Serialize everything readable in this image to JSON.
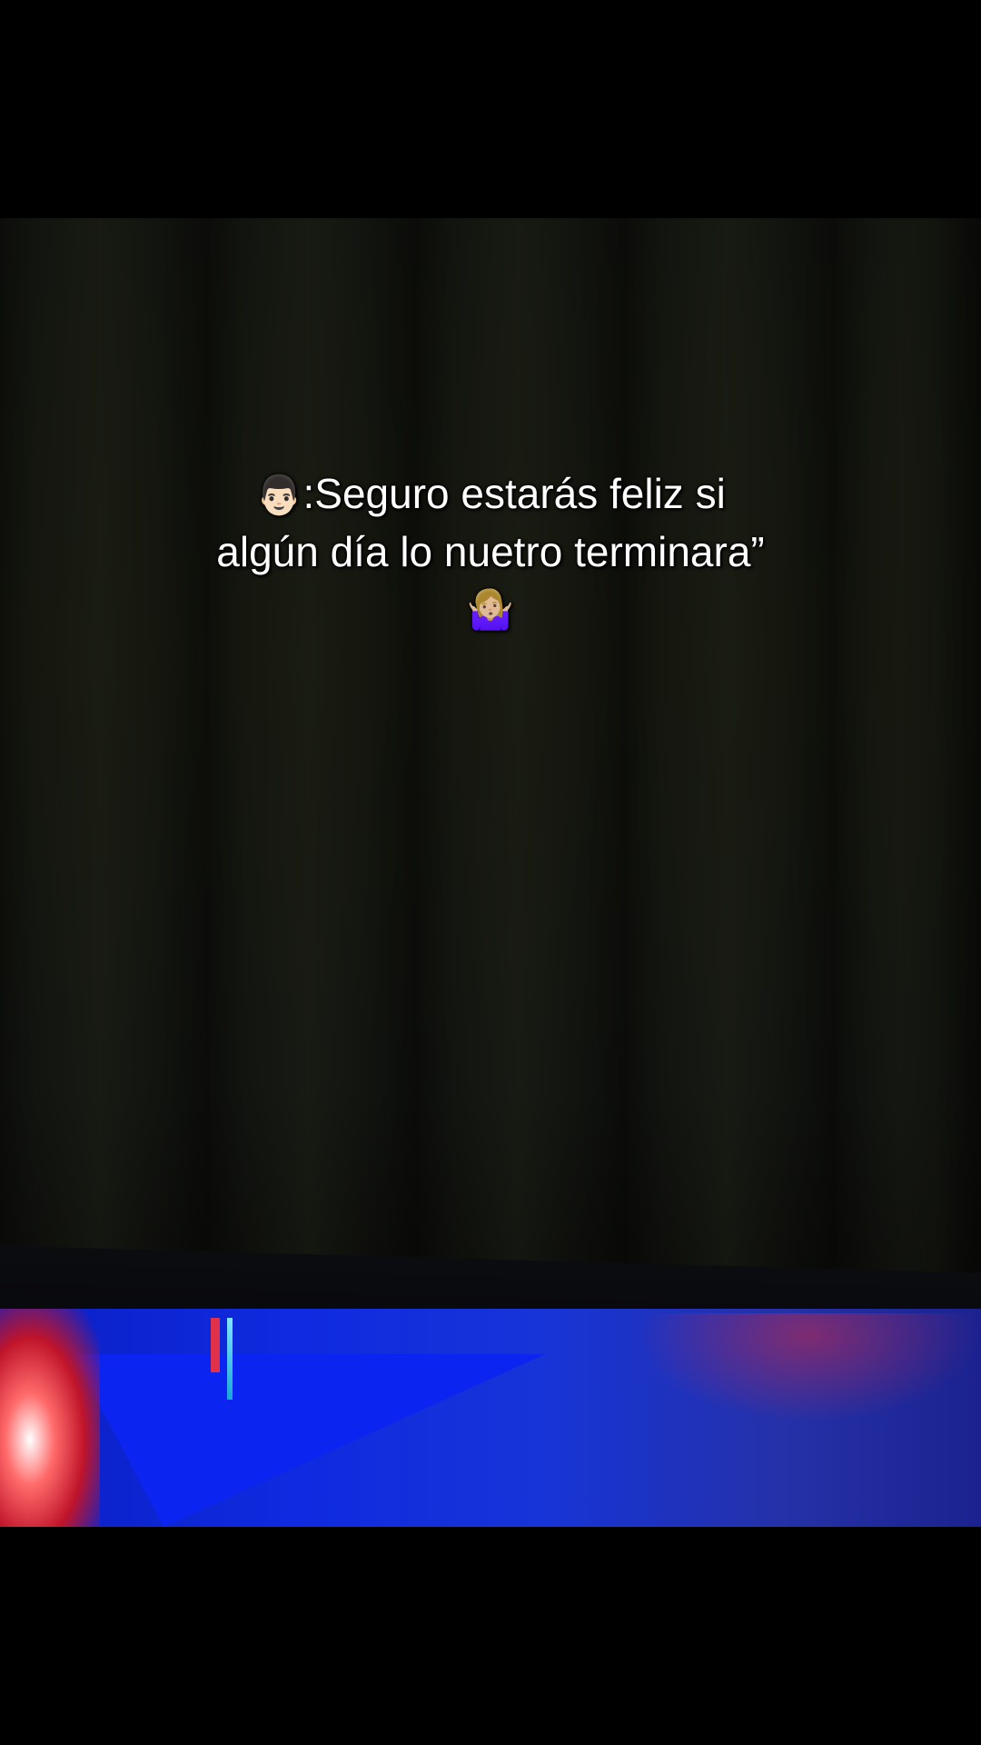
{
  "caption": {
    "speaker_emoji": "👨🏻",
    "line1": ":Seguro estarás feliz si",
    "line2": "algún día lo nuetro terminara”",
    "reaction_emoji": "🤷🏼‍♀️"
  },
  "colors": {
    "background": "#000000",
    "curtain": "#15170f",
    "tv_blue": "#0f2ae0",
    "tv_red": "#c0142a",
    "caption_text": "#ffffff"
  }
}
